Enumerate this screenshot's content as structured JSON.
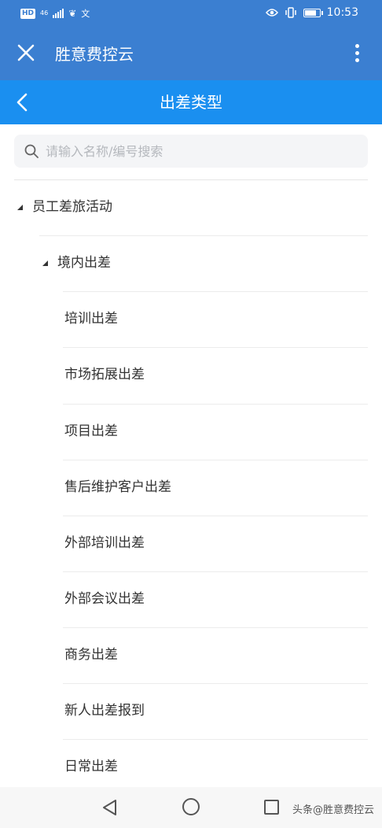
{
  "status_bar": {
    "hd": "HD",
    "network": "46",
    "ime": "文",
    "time": "10:53"
  },
  "app": {
    "title": "胜意费控云"
  },
  "page": {
    "title": "出差类型"
  },
  "search": {
    "placeholder": "请输入名称/编号搜索",
    "value": ""
  },
  "tree": {
    "root": {
      "label": "员工差旅活动",
      "expanded": true
    },
    "group": {
      "label": "境内出差",
      "expanded": true
    },
    "items": [
      {
        "label": "培训出差"
      },
      {
        "label": "市场拓展出差"
      },
      {
        "label": "项目出差"
      },
      {
        "label": "售后维护客户出差"
      },
      {
        "label": "外部培训出差"
      },
      {
        "label": "外部会议出差"
      },
      {
        "label": "商务出差"
      },
      {
        "label": "新人出差报到"
      },
      {
        "label": "日常出差"
      }
    ]
  },
  "watermark": "头条@胜意费控云",
  "colors": {
    "app_bar": "#3b7fd1",
    "page_header": "#1a8ff0"
  }
}
